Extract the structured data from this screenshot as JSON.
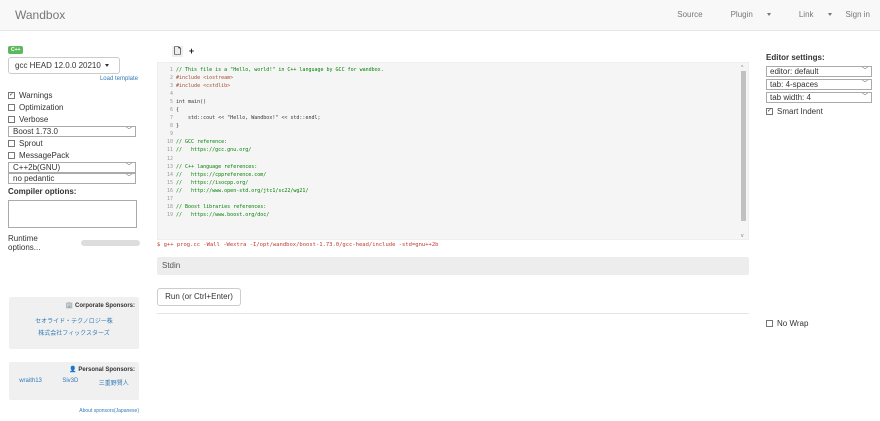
{
  "navbar": {
    "brand": "Wandbox",
    "source": "Source",
    "plugin": "Plugin",
    "link": "Link",
    "signin": "Sign in"
  },
  "left": {
    "language_badge": "C++",
    "compiler": "gcc HEAD 12.0.0 20210",
    "load_template": "Load template",
    "warnings": "Warnings",
    "optimization": "Optimization",
    "verbose": "Verbose",
    "boost_select": "Boost 1.73.0",
    "sprout": "Sprout",
    "messagepack": "MessagePack",
    "std_select": "C++2b(GNU)",
    "pedantic_select": "no pedantic",
    "compiler_options_label": "Compiler options:",
    "runtime_options": "Runtime options...",
    "checked": {
      "warnings": true,
      "optimization": false,
      "verbose": false,
      "sprout": false,
      "messagepack": false
    }
  },
  "sponsors": {
    "corporate_title": "Corporate Sponsors:",
    "corporate_1": "セオライド・テクノロジー株",
    "corporate_2": "株式会社フィックスターズ",
    "personal_title": "Personal Sponsors:",
    "personal_1": "wraith13",
    "personal_2": "Siv3D",
    "personal_3": "三重野賢人",
    "about": "About sponsors(Japanese)"
  },
  "editor": {
    "toolbar": {
      "file_icon": "file-icon",
      "add_icon": "plus-icon"
    },
    "lines": [
      {
        "n": "1",
        "t": "// This file is a \"Hello, world!\" in C++ language by GCC for wandbox.",
        "c": "c-com"
      },
      {
        "n": "2",
        "t": "#include <iostream>",
        "c": "c-pre"
      },
      {
        "n": "3",
        "t": "#include <cstdlib>",
        "c": "c-pre"
      },
      {
        "n": "4",
        "t": "",
        "c": "code"
      },
      {
        "n": "5",
        "t": "int main()",
        "c": "code"
      },
      {
        "n": "6",
        "t": "{",
        "c": "code"
      },
      {
        "n": "7",
        "t": "    std::cout << \"Hello, Wandbox!\" << std::endl;",
        "c": "code"
      },
      {
        "n": "8",
        "t": "}",
        "c": "code"
      },
      {
        "n": "9",
        "t": "",
        "c": "code"
      },
      {
        "n": "10",
        "t": "// GCC reference:",
        "c": "c-com"
      },
      {
        "n": "11",
        "t": "//   https://gcc.gnu.org/",
        "c": "c-com"
      },
      {
        "n": "12",
        "t": "",
        "c": "code"
      },
      {
        "n": "13",
        "t": "// C++ language references:",
        "c": "c-com"
      },
      {
        "n": "14",
        "t": "//   https://cppreference.com/",
        "c": "c-com"
      },
      {
        "n": "15",
        "t": "//   https://isocpp.org/",
        "c": "c-com"
      },
      {
        "n": "16",
        "t": "//   http://www.open-std.org/jtc1/sc22/wg21/",
        "c": "c-com"
      },
      {
        "n": "17",
        "t": "",
        "c": "code"
      },
      {
        "n": "18",
        "t": "// Boost libraries references:",
        "c": "c-com"
      },
      {
        "n": "19",
        "t": "//   https://www.boost.org/doc/",
        "c": "c-com"
      }
    ],
    "cmdline": "$ g++ prog.cc -Wall -Wextra -I/opt/wandbox/boost-1.73.0/gcc-head/include -std=gnu++2b"
  },
  "stdin_label": "Stdin",
  "run_button": "Run (or Ctrl+Enter)",
  "settings": {
    "title": "Editor settings:",
    "editor": "editor: default",
    "tab": "tab: 4-spaces",
    "tab_width": "tab width: 4",
    "smart_indent": "Smart Indent",
    "no_wrap": "No Wrap"
  },
  "colors": {
    "badge": "#5cb85c",
    "link": "#337ab7",
    "cmd": "#c0392b"
  }
}
